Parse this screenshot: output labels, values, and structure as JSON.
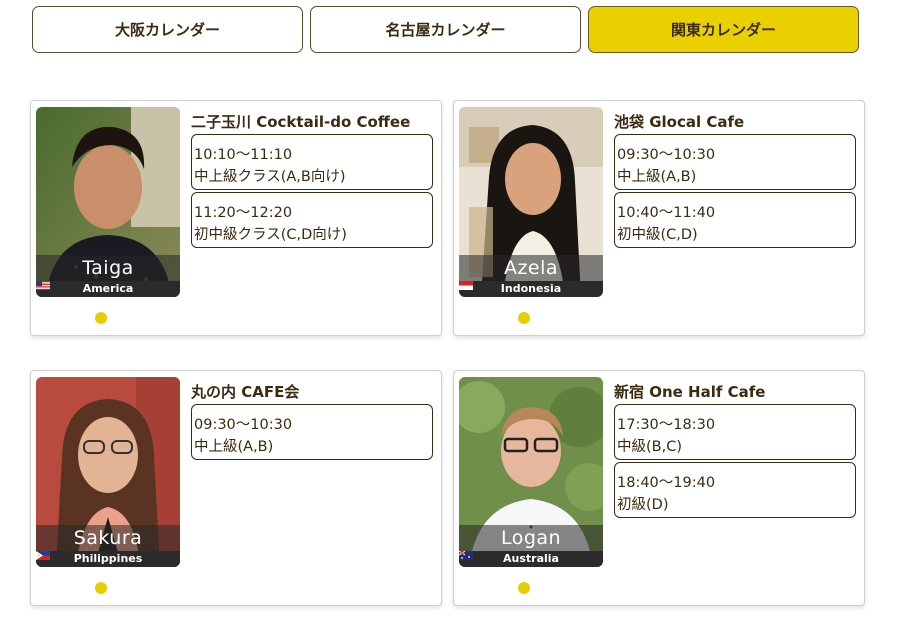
{
  "tabs": [
    {
      "label": "大阪カレンダー",
      "active": false
    },
    {
      "label": "名古屋カレンダー",
      "active": false
    },
    {
      "label": "関東カレンダー",
      "active": true
    }
  ],
  "colors": {
    "accent": "#ead000",
    "text": "#3b2b10",
    "dot": "#e6cf00"
  },
  "cards": [
    {
      "teacher": "Taiga",
      "country": "America",
      "flag_icon": "us-flag-icon",
      "venue": "二子玉川 Cocktail-do Coffee",
      "slots": [
        {
          "time": "10:10〜11:10",
          "level": "中上級クラス(A,B向け)"
        },
        {
          "time": "11:20〜12:20",
          "level": "初中級クラス(C,D向け)"
        }
      ]
    },
    {
      "teacher": "Azela",
      "country": "Indonesia",
      "flag_icon": "indonesia-flag-icon",
      "venue": "池袋 Glocal Cafe",
      "slots": [
        {
          "time": "09:30〜10:30",
          "level": "中上級(A,B)"
        },
        {
          "time": "10:40〜11:40",
          "level": "初中級(C,D)"
        }
      ]
    },
    {
      "teacher": "Sakura",
      "country": "Philippines",
      "flag_icon": "philippines-flag-icon",
      "venue": "丸の内 CAFE会",
      "slots": [
        {
          "time": "09:30〜10:30",
          "level": "中上級(A,B)"
        }
      ]
    },
    {
      "teacher": "Logan",
      "country": "Australia",
      "flag_icon": "australia-flag-icon",
      "venue": "新宿 One Half Cafe",
      "slots": [
        {
          "time": "17:30〜18:30",
          "level": "中級(B,C)"
        },
        {
          "time": "18:40〜19:40",
          "level": "初級(D)"
        }
      ]
    }
  ]
}
